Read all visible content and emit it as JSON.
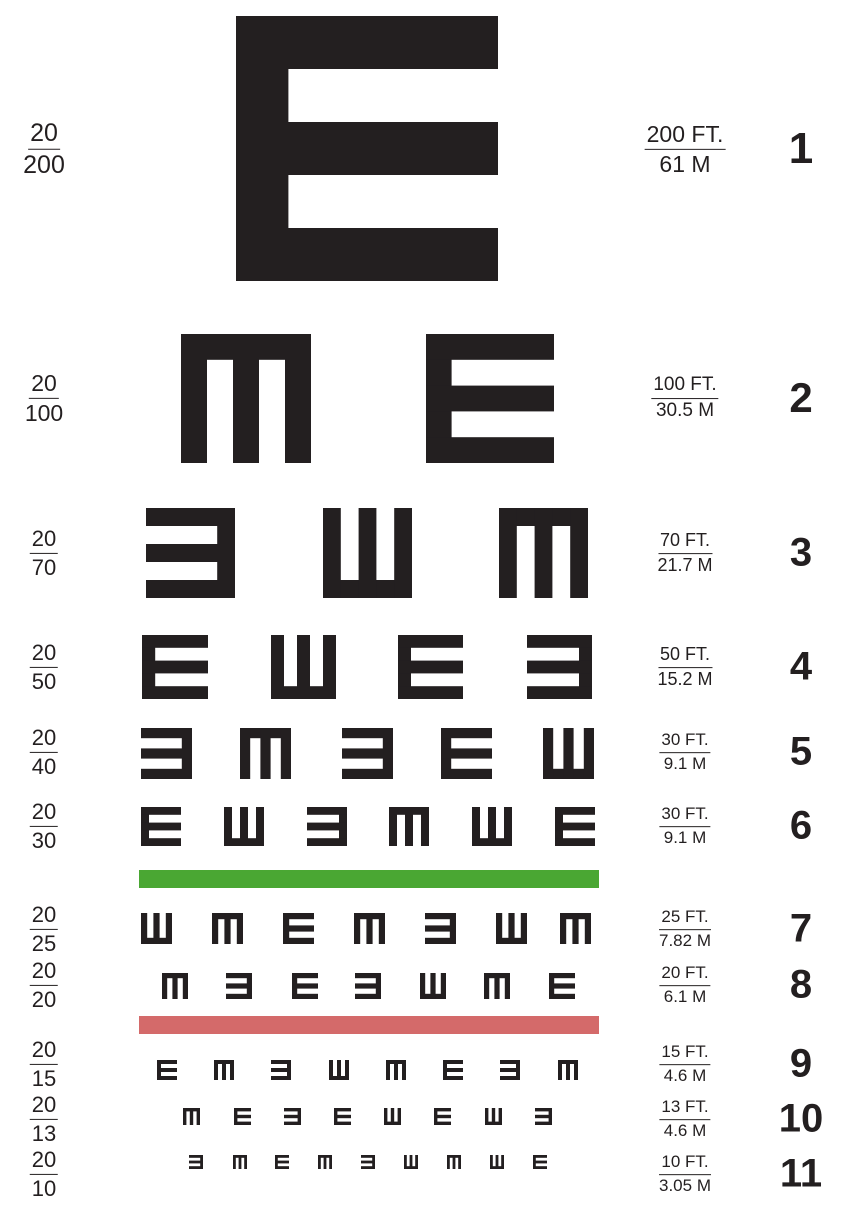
{
  "colors": {
    "ink": "#231f20",
    "green_bar": "#4aa733",
    "red_bar": "#d46a6a",
    "background": "#ffffff"
  },
  "rows": [
    {
      "number": "1",
      "snellen": {
        "numerator": "20",
        "denominator": "200"
      },
      "distance": {
        "feet": "200 FT.",
        "meters": "61 M"
      },
      "letters": [
        "E"
      ]
    },
    {
      "number": "2",
      "snellen": {
        "numerator": "20",
        "denominator": "100"
      },
      "distance": {
        "feet": "100 FT.",
        "meters": "30.5 M"
      },
      "letters": [
        "M",
        "E"
      ]
    },
    {
      "number": "3",
      "snellen": {
        "numerator": "20",
        "denominator": "70"
      },
      "distance": {
        "feet": "70 FT.",
        "meters": "21.7 M"
      },
      "letters": [
        "3",
        "W",
        "M"
      ]
    },
    {
      "number": "4",
      "snellen": {
        "numerator": "20",
        "denominator": "50"
      },
      "distance": {
        "feet": "50 FT.",
        "meters": "15.2 M"
      },
      "letters": [
        "E",
        "W",
        "E",
        "3"
      ]
    },
    {
      "number": "5",
      "snellen": {
        "numerator": "20",
        "denominator": "40"
      },
      "distance": {
        "feet": "30 FT.",
        "meters": "9.1 M"
      },
      "letters": [
        "3",
        "M",
        "3",
        "E",
        "W"
      ]
    },
    {
      "number": "6",
      "snellen": {
        "numerator": "20",
        "denominator": "30"
      },
      "distance": {
        "feet": "30 FT.",
        "meters": "9.1 M"
      },
      "letters": [
        "E",
        "W",
        "3",
        "M",
        "W",
        "E"
      ]
    },
    {
      "number": "7",
      "snellen": {
        "numerator": "20",
        "denominator": "25"
      },
      "distance": {
        "feet": "25 FT.",
        "meters": "7.82 M"
      },
      "letters": [
        "W",
        "M",
        "E",
        "M",
        "3",
        "W",
        "M"
      ]
    },
    {
      "number": "8",
      "snellen": {
        "numerator": "20",
        "denominator": "20"
      },
      "distance": {
        "feet": "20 FT.",
        "meters": "6.1 M"
      },
      "letters": [
        "M",
        "3",
        "E",
        "3",
        "W",
        "M",
        "E"
      ]
    },
    {
      "number": "9",
      "snellen": {
        "numerator": "20",
        "denominator": "15"
      },
      "distance": {
        "feet": "15 FT.",
        "meters": "4.6 M"
      },
      "letters": [
        "E",
        "M",
        "3",
        "W",
        "M",
        "E",
        "3",
        "M"
      ]
    },
    {
      "number": "10",
      "snellen": {
        "numerator": "20",
        "denominator": "13"
      },
      "distance": {
        "feet": "13 FT.",
        "meters": "4.6 M"
      },
      "letters": [
        "M",
        "E",
        "3",
        "E",
        "W",
        "E",
        "W",
        "3"
      ]
    },
    {
      "number": "11",
      "snellen": {
        "numerator": "20",
        "denominator": "10"
      },
      "distance": {
        "feet": "10 FT.",
        "meters": "3.05 M"
      },
      "letters": [
        "3",
        "M",
        "E",
        "M",
        "3",
        "W",
        "M",
        "W",
        "E"
      ]
    }
  ]
}
